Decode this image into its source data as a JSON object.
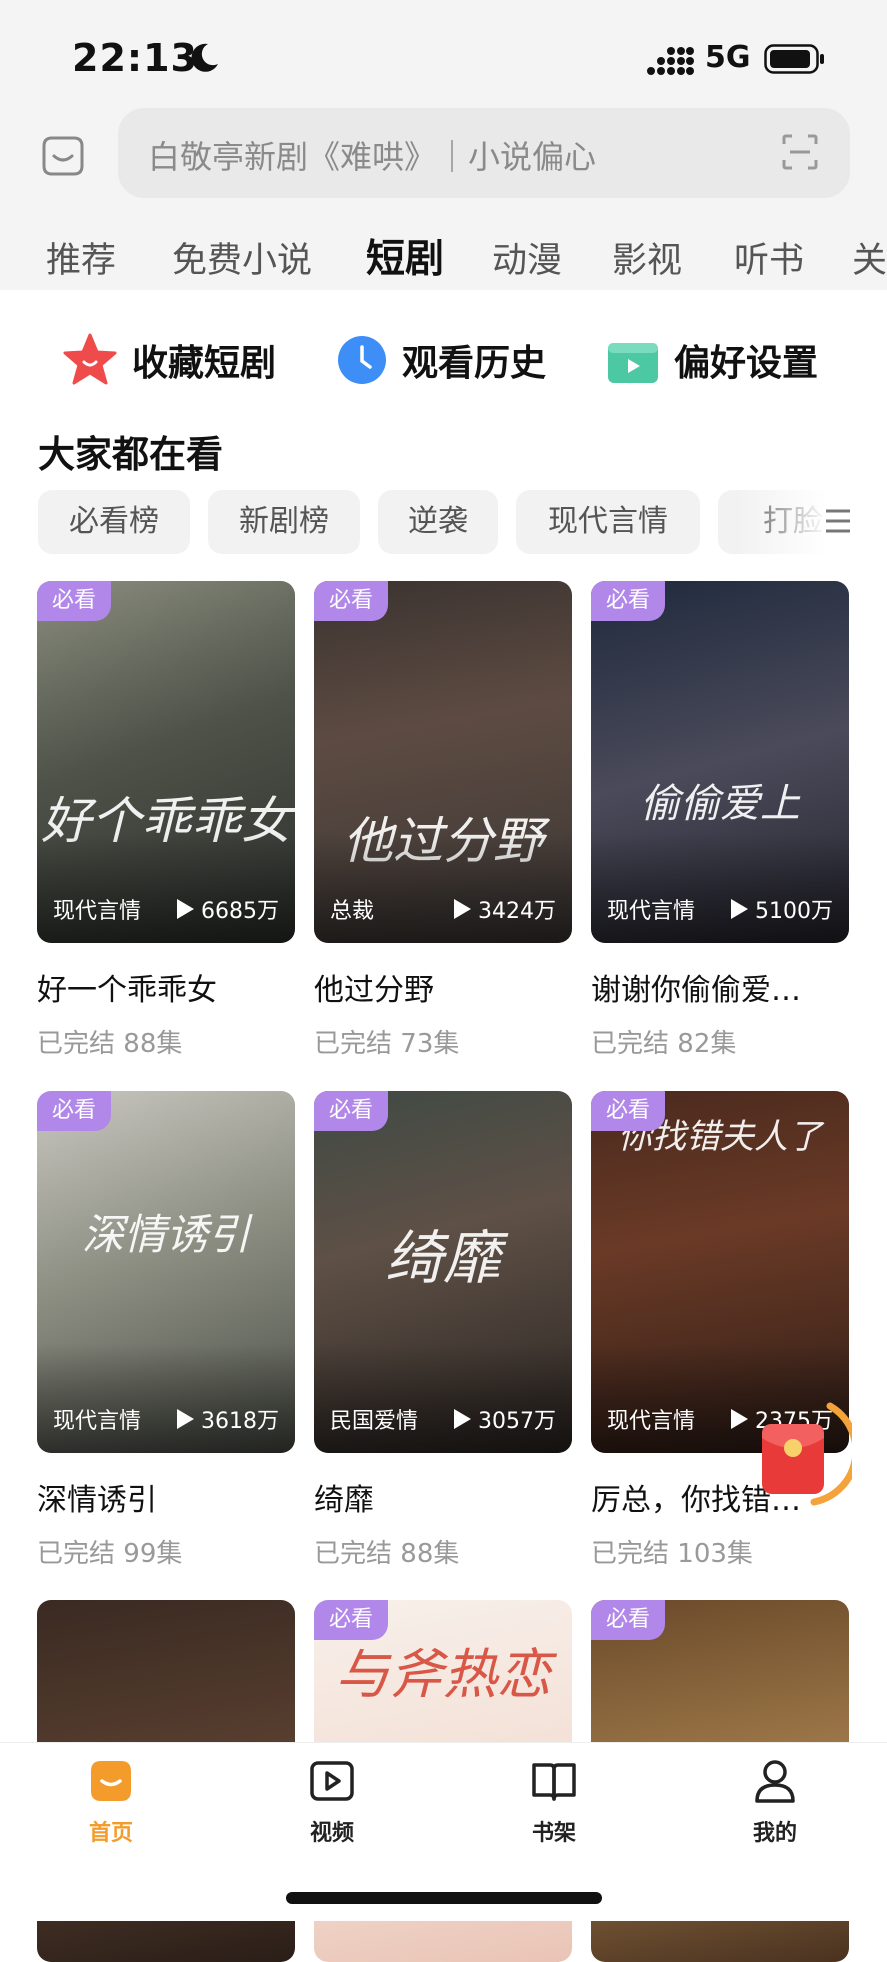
{
  "status": {
    "time": "22:13",
    "network": "5G"
  },
  "search": {
    "placeholder": "白敬亭新剧《难哄》｜小说偏心"
  },
  "tabs": [
    "推荐",
    "免费小说",
    "短剧",
    "动漫",
    "影视",
    "听书",
    "关"
  ],
  "active_tab": "短剧",
  "quick_actions": {
    "favorites": "收藏短剧",
    "history": "观看历史",
    "preferences": "偏好设置"
  },
  "section_title": "大家都在看",
  "chips": [
    "必看榜",
    "新剧榜",
    "逆袭",
    "现代言情",
    "打脸"
  ],
  "cards": [
    {
      "badge": "必看",
      "genre": "现代言情",
      "views": "6685万",
      "title": "好一个乖乖女",
      "status": "已完结",
      "episodes": "88集",
      "poster_text": "好个乖乖女"
    },
    {
      "badge": "必看",
      "genre": "总裁",
      "views": "3424万",
      "title": "他过分野",
      "status": "已完结",
      "episodes": "73集",
      "poster_text": "他过分野"
    },
    {
      "badge": "必看",
      "genre": "现代言情",
      "views": "5100万",
      "title": "谢谢你偷偷爱…",
      "status": "已完结",
      "episodes": "82集",
      "poster_text": "偷偷爱上"
    },
    {
      "badge": "必看",
      "genre": "现代言情",
      "views": "3618万",
      "title": "深情诱引",
      "status": "已完结",
      "episodes": "99集",
      "poster_text": "深情诱引"
    },
    {
      "badge": "必看",
      "genre": "民国爱情",
      "views": "3057万",
      "title": "绮靡",
      "status": "已完结",
      "episodes": "88集",
      "poster_text": "绮靡"
    },
    {
      "badge": "必看",
      "genre": "现代言情",
      "views": "2375万",
      "title": "厉总，你找错…",
      "status": "已完结",
      "episodes": "103集",
      "poster_text": "你找错夫人了"
    },
    {
      "badge": "",
      "poster_text": ""
    },
    {
      "badge": "必看",
      "poster_text": "与斧热恋"
    },
    {
      "badge": "必看",
      "poster_text": ""
    }
  ],
  "bottom_nav": {
    "home": "首页",
    "video": "视频",
    "shelf": "书架",
    "me": "我的"
  },
  "colors": {
    "accent": "#f39c2b",
    "badge": "#b188ea"
  }
}
